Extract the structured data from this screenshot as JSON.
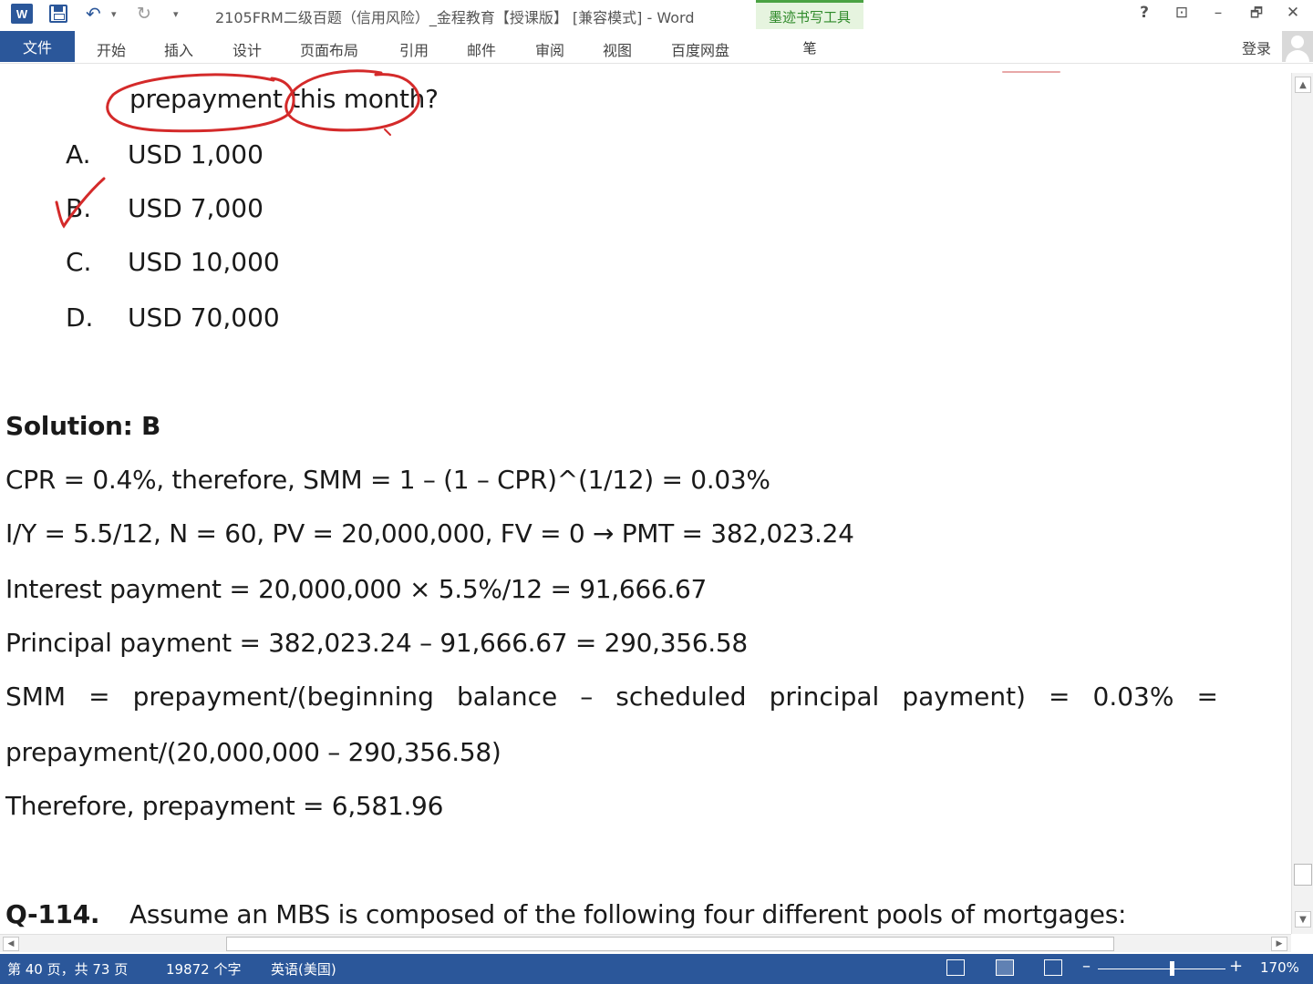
{
  "window": {
    "title": "2105FRM二级百题（信用风险）_金程教育【授课版】 [兼容模式] - Word",
    "ink_tools_label": "墨迹书写工具",
    "ink_tab": "笔",
    "help": "?",
    "restore_ribbon": "⊡",
    "minimize": "–",
    "maximize": "🗗",
    "close": "✕"
  },
  "quick_access": {
    "app_icon": "W",
    "undo_icon": "↶",
    "undo_dropdown": "▾",
    "redo_icon": "↻",
    "customize_icon": "▾"
  },
  "ribbon": {
    "file": "文件",
    "tabs": [
      "开始",
      "插入",
      "设计",
      "页面布局",
      "引用",
      "邮件",
      "审阅",
      "视图",
      "百度网盘"
    ],
    "login": "登录"
  },
  "document": {
    "question_tail": "prepayment this month?",
    "options": [
      {
        "letter": "A.",
        "text": "USD 1,000"
      },
      {
        "letter": "B.",
        "text": "USD 7,000"
      },
      {
        "letter": "C.",
        "text": "USD 10,000"
      },
      {
        "letter": "D.",
        "text": "USD 70,000"
      }
    ],
    "solution_heading": "Solution: B",
    "lines": [
      "CPR = 0.4%, therefore, SMM = 1 – (1 – CPR)^(1/12) = 0.03%",
      "I/Y = 5.5/12, N = 60, PV = 20,000,000, FV = 0 → PMT = 382,023.24",
      "Interest payment = 20,000,000 × 5.5%/12 = 91,666.67",
      "Principal payment = 382,023.24 – 91,666.67 = 290,356.58"
    ],
    "smm_words": [
      "SMM",
      "=",
      "prepayment/(beginning",
      "balance",
      "–",
      "scheduled",
      "principal",
      "payment)",
      "=",
      "0.03%",
      "="
    ],
    "smm_continuation": "prepayment/(20,000,000 – 290,356.58)",
    "conclusion": "Therefore, prepayment = 6,581.96",
    "next_question_label": "Q-114.",
    "next_question_text": "Assume an MBS is composed of the following four different pools of mortgages:",
    "ink_color": "#d42a2a"
  },
  "scrollbars": {
    "up": "▲",
    "down": "▼",
    "left": "◀",
    "right": "▶"
  },
  "status": {
    "page": "第 40 页，共 73 页",
    "words": "19872 个字",
    "language": "英语(美国)",
    "zoom": "170%",
    "zoom_minus": "–",
    "zoom_plus": "+"
  }
}
